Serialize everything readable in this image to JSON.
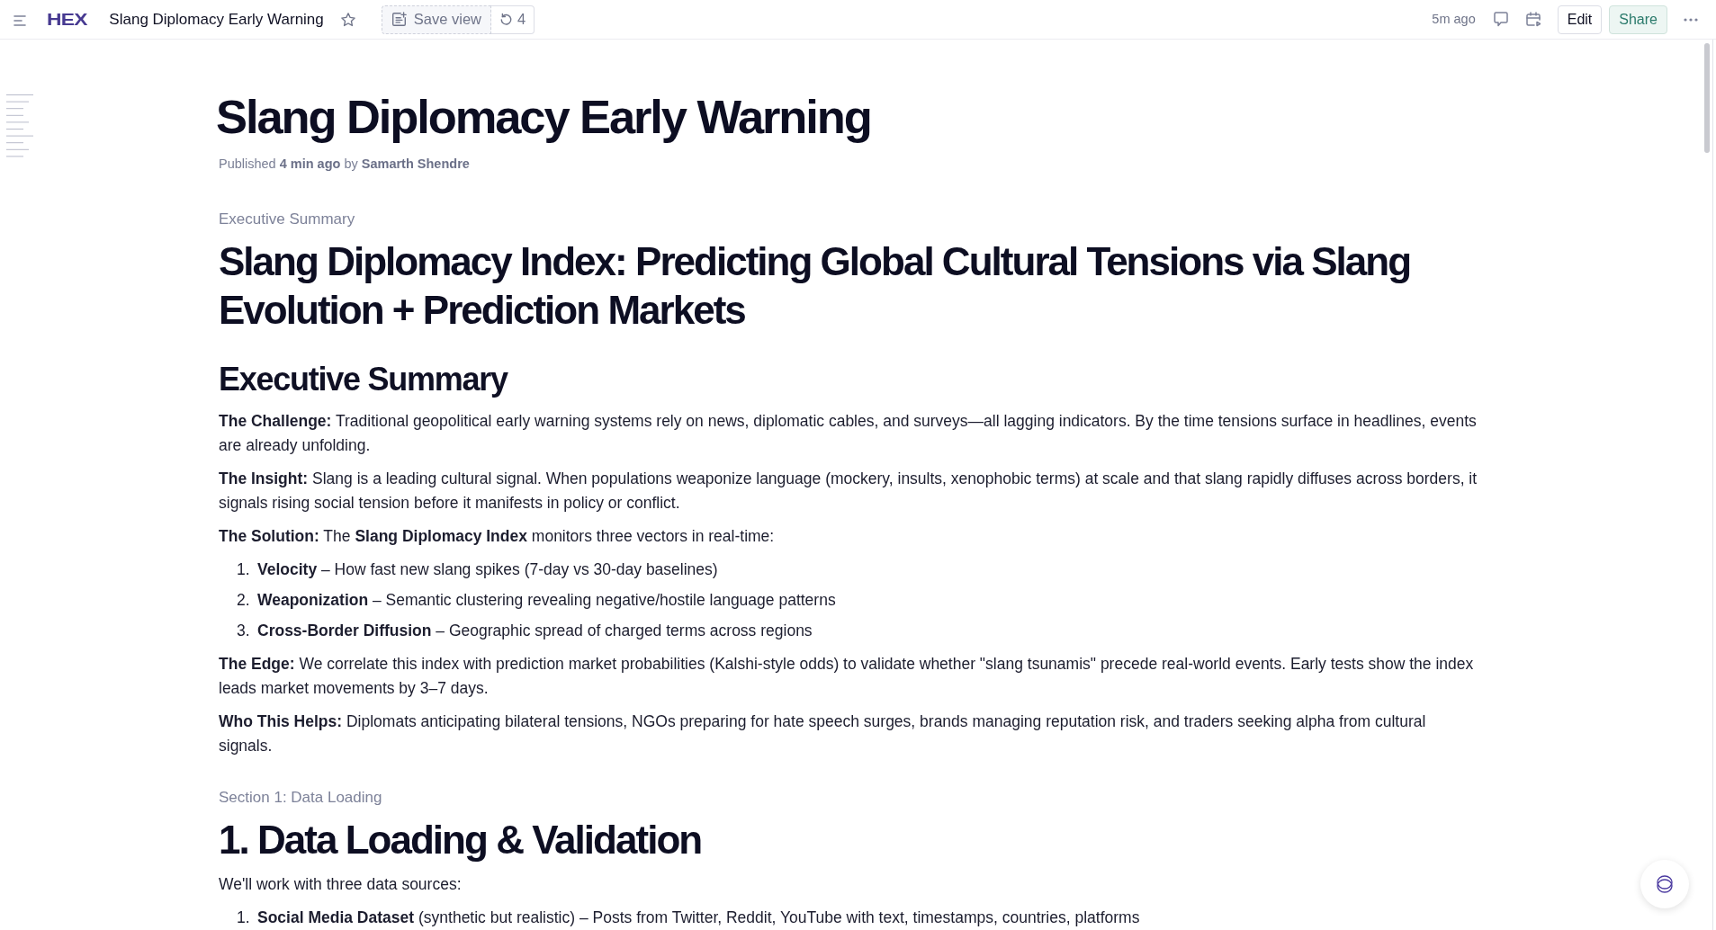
{
  "top_bar": {
    "logo": "HEX",
    "title": "Slang Diplomacy Early Warning",
    "starred": false,
    "save_view": "Save view",
    "versions": "4",
    "last_saved": "5m ago",
    "edit": "Edit",
    "share": "Share"
  },
  "document": {
    "title": "Slang Diplomacy Early Warning",
    "byline": "Published **4 min ago** by **Samarth Shendre**"
  },
  "sections": [
    {
      "label": "Executive Summary",
      "heading": "Slang Diplomacy Index: Predicting Global Cultural Tensions via Slang Evolution + Prediction Markets",
      "blocks": [
        {
          "kind": "subheading",
          "text": "Executive Summary"
        },
        {
          "kind": "paragraph",
          "text": "**The Challenge:** Traditional geopolitical early warning systems rely on news, diplomatic cables, and surveys—all lagging indicators. By the time tensions surface in headlines, events are already unfolding."
        },
        {
          "kind": "paragraph",
          "text": "**The Insight:** Slang is a leading cultural signal. When populations weaponize language (mockery, insults, xenophobic terms) at scale and that slang rapidly diffuses across borders, it signals rising social tension before it manifests in policy or conflict."
        },
        {
          "kind": "paragraph",
          "text": "**The Solution:** The **Slang Diplomacy Index** monitors three vectors in real-time:"
        },
        {
          "kind": "list",
          "items": [
            {
              "number": "1.",
              "text": "**Velocity** – How fast new slang spikes (7-day vs 30-day baselines)"
            },
            {
              "number": "2.",
              "text": "**Weaponization** – Semantic clustering revealing negative/hostile language patterns"
            },
            {
              "number": "3.",
              "text": "**Cross-Border Diffusion** – Geographic spread of charged terms across regions"
            }
          ]
        },
        {
          "kind": "paragraph",
          "text": "**The Edge:** We correlate this index with prediction market probabilities (Kalshi-style odds) to validate whether \"slang tsunamis\" precede real-world events. Early tests show the index leads market movements by 3–7 days."
        },
        {
          "kind": "paragraph",
          "text": "**Who This Helps:** Diplomats anticipating bilateral tensions, NGOs preparing for hate speech surges, brands managing reputation risk, and traders seeking alpha from cultural signals."
        }
      ]
    },
    {
      "label": "Section 1: Data Loading",
      "heading": "1. Data Loading & Validation",
      "blocks": [
        {
          "kind": "paragraph",
          "text": "We'll work with three data sources:"
        },
        {
          "kind": "list",
          "items": [
            {
              "number": "1.",
              "text": "**Social Media Dataset** (synthetic but realistic) – Posts from Twitter, Reddit, YouTube with text, timestamps, countries, platforms"
            }
          ]
        }
      ]
    }
  ]
}
